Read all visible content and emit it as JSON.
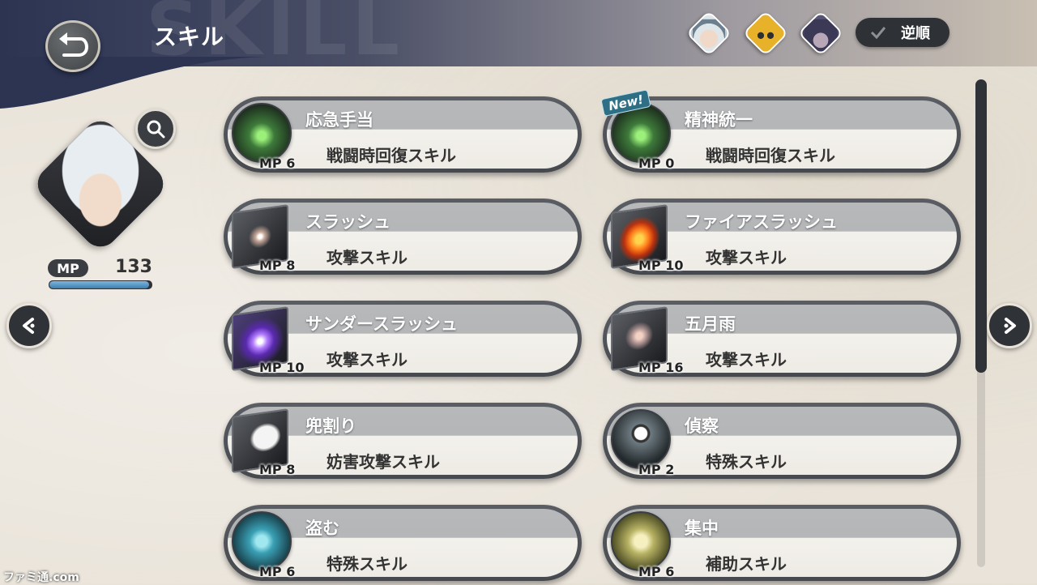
{
  "header": {
    "title": "スキル",
    "watermark": "SKILL",
    "sort_label": "逆順",
    "characters": [
      "white-hair-hero",
      "yellow-robot",
      "dark-hair-character"
    ]
  },
  "character": {
    "mp_label": "MP",
    "mp_value": "133",
    "mp_fraction": 0.98
  },
  "skills": [
    {
      "name": "応急手当",
      "type": "戦闘時回復スキル",
      "mp": "MP 6",
      "icon": "heal-orb-icon"
    },
    {
      "name": "精神統一",
      "type": "戦闘時回復スキル",
      "mp": "MP 0",
      "icon": "heal-orb-icon",
      "new": "New!"
    },
    {
      "name": "スラッシュ",
      "type": "攻撃スキル",
      "mp": "MP 8",
      "icon": "slash-cube-icon"
    },
    {
      "name": "ファイアスラッシュ",
      "type": "攻撃スキル",
      "mp": "MP 10",
      "icon": "fire-cube-icon"
    },
    {
      "name": "サンダースラッシュ",
      "type": "攻撃スキル",
      "mp": "MP 10",
      "icon": "thunder-cube-icon"
    },
    {
      "name": "五月雨",
      "type": "攻撃スキル",
      "mp": "MP 16",
      "icon": "rain-cube-icon"
    },
    {
      "name": "兜割り",
      "type": "妨害攻撃スキル",
      "mp": "MP 8",
      "icon": "shield-break-cube-icon"
    },
    {
      "name": "偵察",
      "type": "特殊スキル",
      "mp": "MP 2",
      "icon": "scout-orb-icon"
    },
    {
      "name": "盗む",
      "type": "特殊スキル",
      "mp": "MP 6",
      "icon": "steal-orb-icon"
    },
    {
      "name": "集中",
      "type": "補助スキル",
      "mp": "MP 6",
      "icon": "focus-orb-icon"
    }
  ],
  "footer": {
    "credit": "ファミ通.com"
  },
  "colors": {
    "accent_dark": "#2f3236",
    "header_navy": "#2c3452",
    "mp_blue": "#3c7fb0"
  }
}
